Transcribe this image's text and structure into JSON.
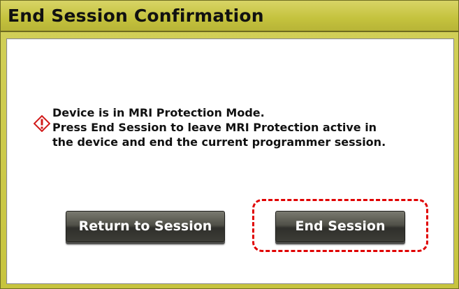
{
  "dialog": {
    "title": "End Session Confirmation"
  },
  "message": {
    "icon": "warning-icon",
    "lines": [
      "Device is in MRI Protection Mode.",
      "Press End Session to leave MRI Protection active in",
      "the device and end the current programmer session."
    ]
  },
  "buttons": {
    "return_label": "Return to Session",
    "end_label": "End Session"
  },
  "colors": {
    "titlebar": "#c7c43e",
    "button": "#3d3d37",
    "highlight": "#e00000",
    "warning_icon": "#d11a1a"
  }
}
